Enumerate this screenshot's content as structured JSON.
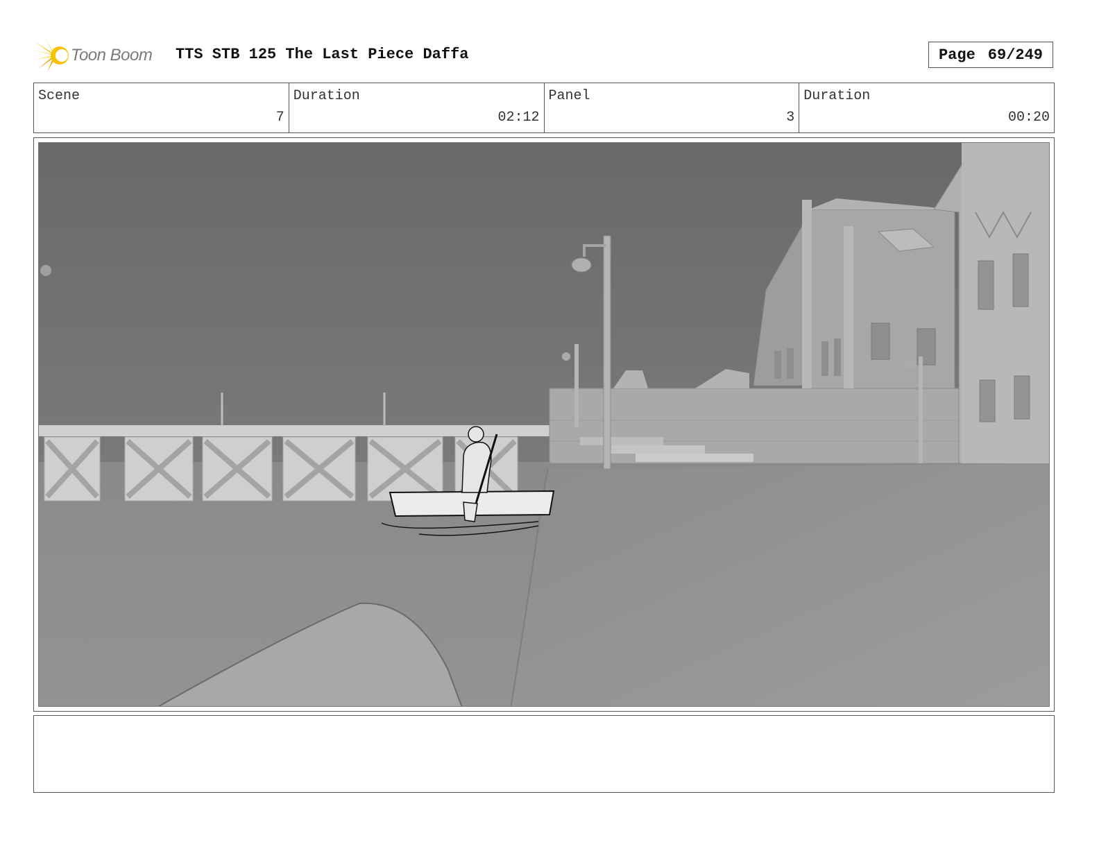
{
  "header": {
    "brand": "Toon Boom",
    "logo_icon": "toon-boom-starburst-icon",
    "project_title": "TTS STB 125 The Last Piece Daffa",
    "page_label": "Page",
    "page_number": "69/249"
  },
  "info": {
    "scene_label": "Scene",
    "scene_value": "7",
    "scene_duration_label": "Duration",
    "scene_duration_value": "02:12",
    "panel_label": "Panel",
    "panel_value": "3",
    "panel_duration_label": "Duration",
    "panel_duration_value": "00:20"
  },
  "notes": {
    "text": ""
  },
  "colors": {
    "logo_yellow": "#f5c400",
    "logo_orange": "#f29a00",
    "sky": "#6f6f6f",
    "water": "#8e8e8e"
  }
}
